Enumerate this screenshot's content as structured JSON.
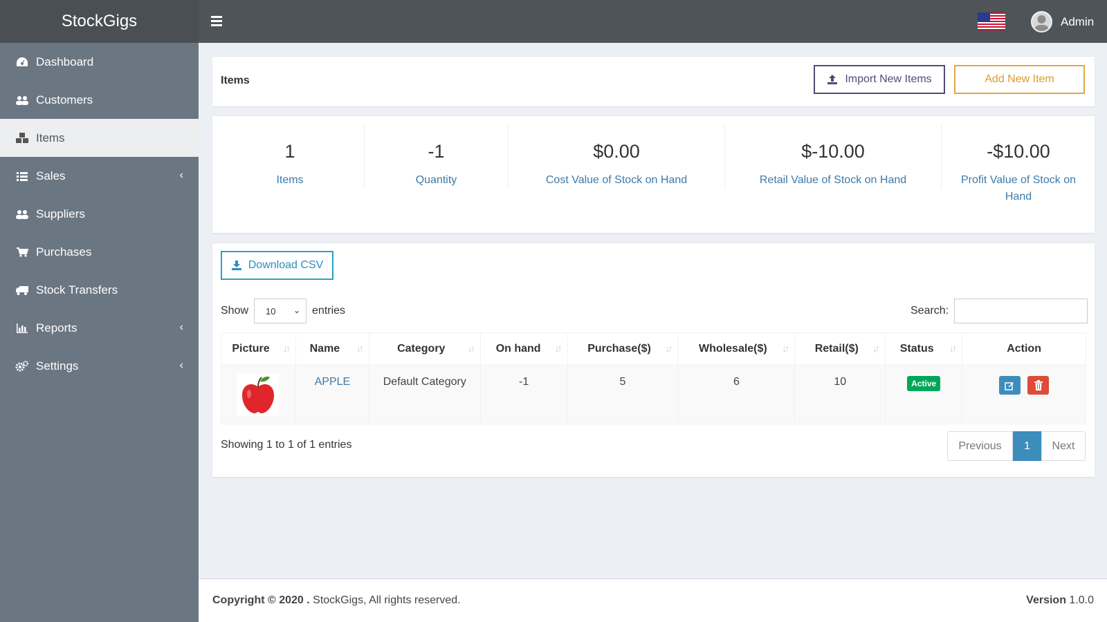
{
  "app": {
    "brand": "StockGigs",
    "user_name": "Admin"
  },
  "sidebar": {
    "items": [
      {
        "label": "Dashboard",
        "icon": "dashboard-icon"
      },
      {
        "label": "Customers",
        "icon": "users-icon"
      },
      {
        "label": "Items",
        "icon": "cubes-icon",
        "active": true
      },
      {
        "label": "Sales",
        "icon": "list-icon",
        "expandable": true
      },
      {
        "label": "Suppliers",
        "icon": "users-icon"
      },
      {
        "label": "Purchases",
        "icon": "cart-icon"
      },
      {
        "label": "Stock Transfers",
        "icon": "truck-icon"
      },
      {
        "label": "Reports",
        "icon": "bar-chart-icon",
        "expandable": true
      },
      {
        "label": "Settings",
        "icon": "gears-icon",
        "expandable": true
      }
    ]
  },
  "header": {
    "title": "Items",
    "import_label": "Import New Items",
    "add_label": "Add New Item"
  },
  "stats": [
    {
      "value": "1",
      "label": "Items"
    },
    {
      "value": "-1",
      "label": "Quantity"
    },
    {
      "value": "$0.00",
      "label": "Cost Value of Stock on Hand"
    },
    {
      "value": "$-10.00",
      "label": "Retail Value of Stock on Hand"
    },
    {
      "value": "-$10.00",
      "label": "Profit Value of Stock on Hand"
    }
  ],
  "table_controls": {
    "download_label": "Download CSV",
    "show_label": "Show",
    "page_size": "10",
    "entries_label": "entries",
    "search_label": "Search:",
    "search_value": ""
  },
  "table": {
    "columns": [
      "Picture",
      "Name",
      "Category",
      "On hand",
      "Purchase($)",
      "Wholesale($)",
      "Retail($)",
      "Status",
      "Action"
    ],
    "rows": [
      {
        "name": "APPLE",
        "category": "Default Category",
        "on_hand": "-1",
        "purchase": "5",
        "wholesale": "6",
        "retail": "10",
        "status": "Active"
      }
    ]
  },
  "pagination": {
    "info": "Showing 1 to 1 of 1 entries",
    "previous": "Previous",
    "current": "1",
    "next": "Next"
  },
  "footer": {
    "copyright_bold": "Copyright © 2020 .",
    "copyright_rest": " StockGigs, All rights reserved.",
    "version_label": "Version",
    "version_value": " 1.0.0"
  },
  "colors": {
    "topbar": "#4f5459",
    "sidebar": "#6b7683",
    "accent_blue": "#3c8dbc",
    "import_border": "#4d4c74",
    "add_border": "#e2a740",
    "csv_border": "#2aa1c5",
    "status_active": "#00a65a",
    "delete_red": "#dd4b39"
  }
}
